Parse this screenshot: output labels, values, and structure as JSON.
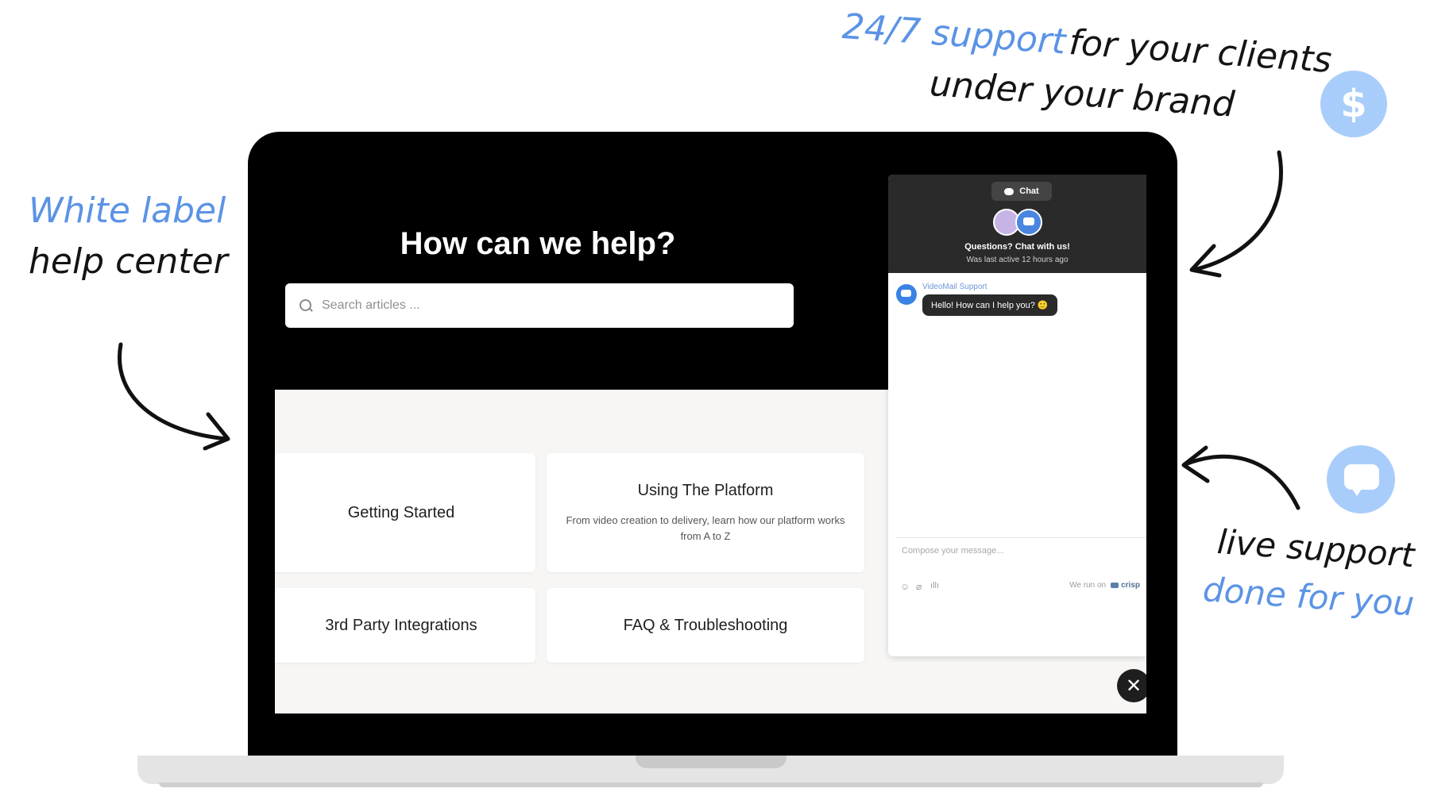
{
  "annotations": {
    "left_line1": "White label",
    "left_line2": "help center",
    "top_right_highlight": "24/7 support",
    "top_right_rest": "for your clients",
    "top_right_line2": "under your brand",
    "bottom_right_line1": "live support",
    "bottom_right_line2": "done for you",
    "accent_color": "#5b93e6"
  },
  "help_center": {
    "title": "How can we help?",
    "search_placeholder": "Search articles ...",
    "categories": [
      {
        "title": "Getting Started",
        "description": ""
      },
      {
        "title": "Using The Platform",
        "description": "From video creation to delivery, learn how our platform works from A to Z"
      },
      {
        "title": "3rd Party Integrations",
        "description": ""
      },
      {
        "title": "FAQ & Troubleshooting",
        "description": ""
      }
    ]
  },
  "chat": {
    "tab_label": "Chat",
    "heading": "Questions? Chat with us!",
    "status": "Was last active 12 hours ago",
    "agent_name": "VideoMail Support",
    "message": "Hello! How can I help you? 🙂",
    "compose_placeholder": "Compose your message...",
    "powered_by_prefix": "We run on",
    "powered_by_brand": "crisp"
  },
  "icons": {
    "dollar_glyph": "$",
    "close_glyph": "✕",
    "emoji_glyph": "☺",
    "attach_glyph": "⌀",
    "audio_glyph": "ıllı"
  }
}
